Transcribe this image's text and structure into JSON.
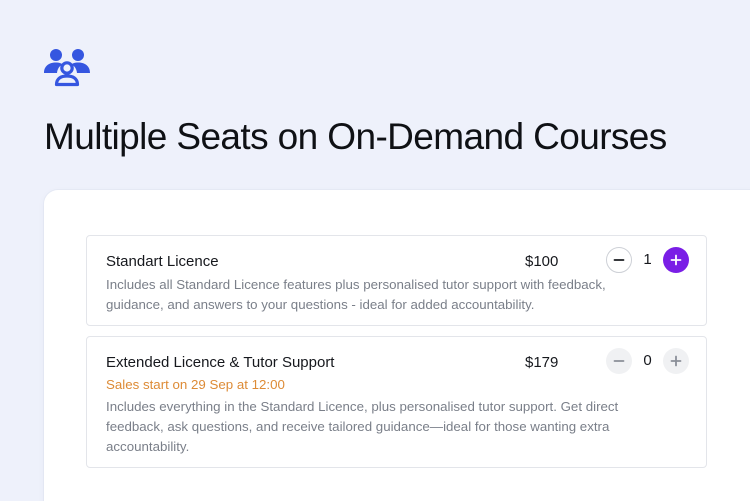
{
  "header": {
    "icon": "users-group-icon",
    "title": "Multiple Seats on On-Demand Courses"
  },
  "colors": {
    "accent": "#7a1ee6",
    "icon_blue": "#3556e0",
    "sales_note": "#dd8b36",
    "background": "#eef1fb"
  },
  "tickets": [
    {
      "name": "Standart Licence",
      "price": "$100",
      "quantity": "1",
      "description": "Includes all Standard Licence features plus personalised tutor support with feedback, guidance, and answers to your questions - ideal for added accountability.",
      "minus_icon": "minus-icon",
      "plus_icon": "plus-icon",
      "plus_enabled": true
    },
    {
      "name": "Extended Licence & Tutor Support",
      "price": "$179",
      "quantity": "0",
      "sales_note": "Sales start on 29 Sep at 12:00",
      "description": "Includes everything in the Standard Licence, plus personalised tutor support. Get direct feedback, ask questions, and receive tailored guidance—ideal for those wanting extra accountability.",
      "minus_icon": "minus-icon",
      "plus_icon": "plus-icon",
      "plus_enabled": false
    }
  ]
}
